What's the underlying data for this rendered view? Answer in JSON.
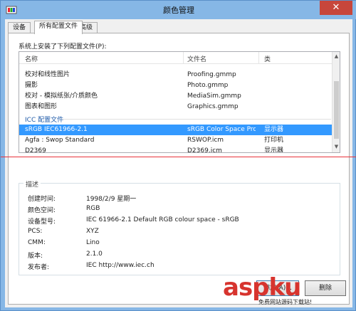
{
  "window": {
    "title": "颜色管理",
    "close_symbol": "✕"
  },
  "tabs": [
    {
      "label": "设备"
    },
    {
      "label": "所有配置文件"
    },
    {
      "label": "高级"
    }
  ],
  "list_caption": "系统上安装了下列配置文件(P):",
  "list": {
    "columns": [
      "名称",
      "文件名",
      "类"
    ],
    "rows": [
      {
        "name": "校对和线性图片",
        "file": "Proofing.gmmp",
        "class": ""
      },
      {
        "name": "摄影",
        "file": "Photo.gmmp",
        "class": ""
      },
      {
        "name": "校对 - 模拟纸张/介质颜色",
        "file": "MediaSim.gmmp",
        "class": ""
      },
      {
        "name": "图表和图形",
        "file": "Graphics.gmmp",
        "class": ""
      }
    ],
    "group_label": "ICC 配置文件",
    "icc_rows": [
      {
        "name": "sRGB IEC61966-2.1",
        "file": "sRGB Color Space Profil...",
        "class": "显示器",
        "selected": true
      },
      {
        "name": "Agfa : Swop Standard",
        "file": "RSWOP.icm",
        "class": "打印机",
        "selected": false
      },
      {
        "name": "D2369",
        "file": "D2369.icm",
        "class": "显示器",
        "selected": false
      }
    ]
  },
  "description": {
    "title": "描述",
    "fields": [
      {
        "key": "创建时间:",
        "value": "1998/2/9 星期一"
      },
      {
        "key": "颜色空间:",
        "value": "RGB"
      },
      {
        "key": "设备型号:",
        "value": "IEC 61966-2.1 Default RGB colour space - sRGB"
      },
      {
        "key": "PCS:",
        "value": "XYZ"
      },
      {
        "key": "CMM:",
        "value": "Lino"
      },
      {
        "key": "版本:",
        "value": "2.1.0"
      },
      {
        "key": "发布者:",
        "value": "IEC http://www.iec.ch"
      }
    ]
  },
  "buttons": {
    "add": "添加(A)...",
    "remove": "删除"
  },
  "watermark": {
    "main": "aspku",
    "sub": "免费网站源码下载站!"
  },
  "colors": {
    "selection": "#3399ff",
    "title_bar": "#86b7e6",
    "close": "#c7463b",
    "watermark": "#d7342e"
  }
}
